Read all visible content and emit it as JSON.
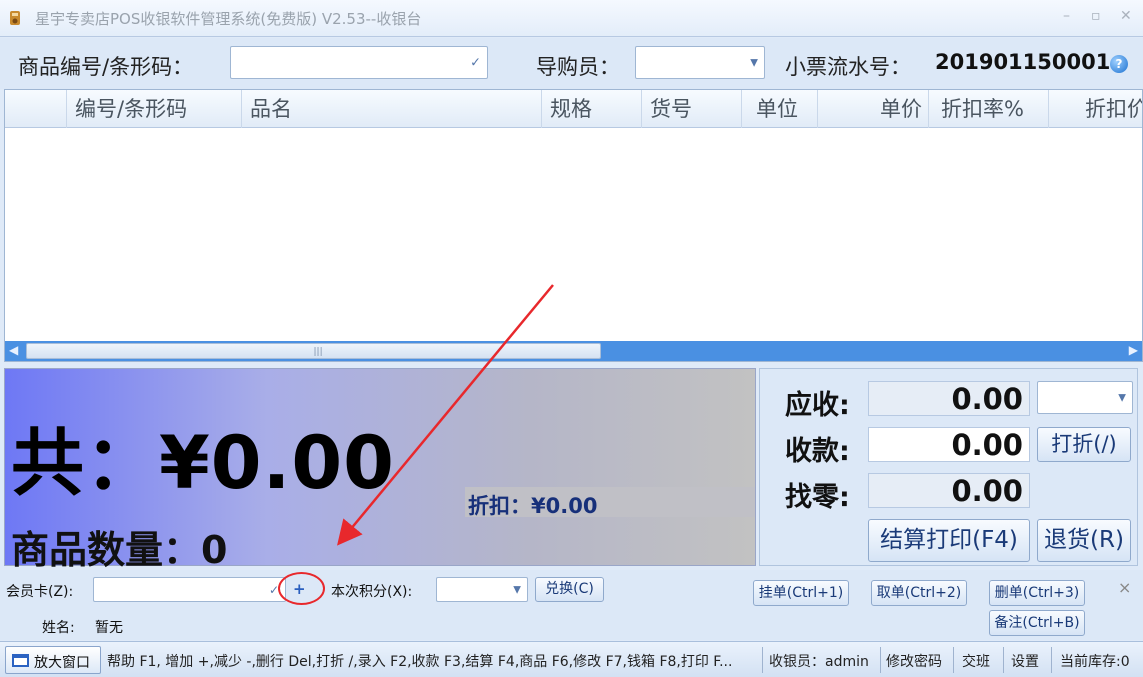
{
  "window": {
    "title": "星宇专卖店POS收银软件管理系统(免费版) V2.53--收银台",
    "minimize": "–",
    "maximize": "▫",
    "close": "✕"
  },
  "topbar": {
    "barcode_label": "商品编号/条形码：",
    "barcode_value": "",
    "guide_label": "导购员：",
    "guide_value": "",
    "serial_label": "小票流水号：",
    "serial_value": "201901150001"
  },
  "grid": {
    "columns": [
      "",
      "编号/条形码",
      "品名",
      "规格",
      "货号",
      "单位",
      "单价",
      "折扣率%",
      "折扣价"
    ],
    "rows": []
  },
  "total": {
    "total_text": "共：¥0.00",
    "qty_text": "商品数量：0",
    "discount_text": "折扣：¥0.00"
  },
  "payment": {
    "receivable_label": "应收:",
    "receivable_value": "0.00",
    "received_label": "收款:",
    "received_value": "0.00",
    "change_label": "找零:",
    "change_value": "0.00",
    "discount_btn": "打折(/)",
    "settle_btn": "结算打印(F4)",
    "return_btn": "退货(R)"
  },
  "member": {
    "card_label": "会员卡(Z):",
    "card_value": "",
    "plus": "+",
    "points_label": "本次积分(X):",
    "points_value": "",
    "redeem_btn": "兑换(C)",
    "name_label": "姓名:",
    "name_value": "暂无"
  },
  "actions": {
    "hold_btn": "挂单(Ctrl+1)",
    "recall_btn": "取单(Ctrl+2)",
    "delete_btn": "删单(Ctrl+3)",
    "note_btn": "备注(Ctrl+B)",
    "close_x": "×"
  },
  "status": {
    "expand_btn": "放大窗口",
    "help_text": "帮助 F1, 增加 +,减少 -,删行 Del,打折 /,录入 F2,收款 F3,结算 F4,商品 F6,修改 F7,钱箱 F8,打印 F...",
    "cashier": "收银员：admin",
    "change_pwd": "修改密码",
    "shift": "交班",
    "settings": "设置",
    "stock": "当前库存:0"
  },
  "colors": {
    "accent": "#1a3a78",
    "annotation": "#e8282c",
    "scrollbar": "#4a90e2"
  }
}
